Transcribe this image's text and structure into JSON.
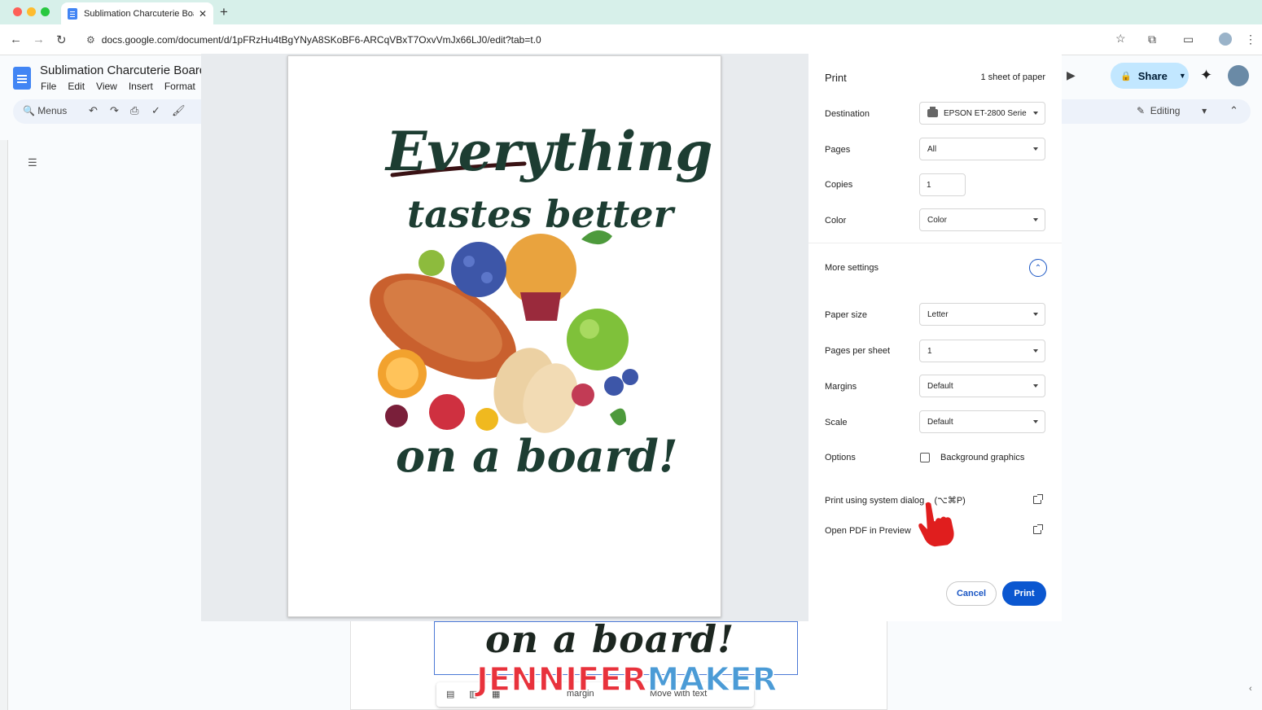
{
  "browser": {
    "tab_title": "Sublimation Charcuterie Boar",
    "tab_close": "✕",
    "new_tab": "+",
    "url": "docs.google.com/document/d/1pFRzHu4tBgYNyA8SKoBF6-ARCqVBxT7OxvVmJx66LJ0/edit?tab=t.0"
  },
  "docs": {
    "title": "Sublimation Charcuterie Board",
    "menu": [
      "File",
      "Edit",
      "View",
      "Insert",
      "Format"
    ],
    "toolbar_menus": "Menus",
    "share_label": "Share",
    "editing_label": "Editing"
  },
  "print_panel": {
    "title": "Print",
    "sheets": "1 sheet of paper",
    "destination_label": "Destination",
    "destination_value": "EPSON ET-2800 Serie",
    "pages_label": "Pages",
    "pages_value": "All",
    "copies_label": "Copies",
    "copies_value": "1",
    "color_label": "Color",
    "color_value": "Color",
    "more_settings_label": "More settings",
    "paper_size_label": "Paper size",
    "paper_size_value": "Letter",
    "pages_per_sheet_label": "Pages per sheet",
    "pages_per_sheet_value": "1",
    "margins_label": "Margins",
    "margins_value": "Default",
    "scale_label": "Scale",
    "scale_value": "Default",
    "options_label": "Options",
    "background_graphics_label": "Background graphics",
    "system_dialog_label": "Print using system dialog... (⌥⌘P)",
    "open_pdf_label": "Open PDF in Preview",
    "cancel_label": "Cancel",
    "print_label": "Print"
  },
  "preview": {
    "line1": "Everything",
    "line2": "tastes better",
    "line3": "on a board!"
  },
  "background_doc": {
    "caption": "on a board!",
    "toolbar_margin": "margin",
    "toolbar_move": "Move with text"
  },
  "watermark": {
    "part1": "JENNIFER",
    "part2": "MAKER"
  },
  "icons": {
    "back": "back-arrow-icon",
    "forward": "forward-arrow-icon",
    "reload": "reload-icon",
    "star": "bookmark-star-icon",
    "extensions": "extensions-icon",
    "printer": "printer-icon",
    "hand_cursor": "hand-pointer-icon"
  },
  "colors": {
    "accent": "#0b57d0",
    "tabbar": "#d7f0ea",
    "text_green": "#1d3d32"
  }
}
